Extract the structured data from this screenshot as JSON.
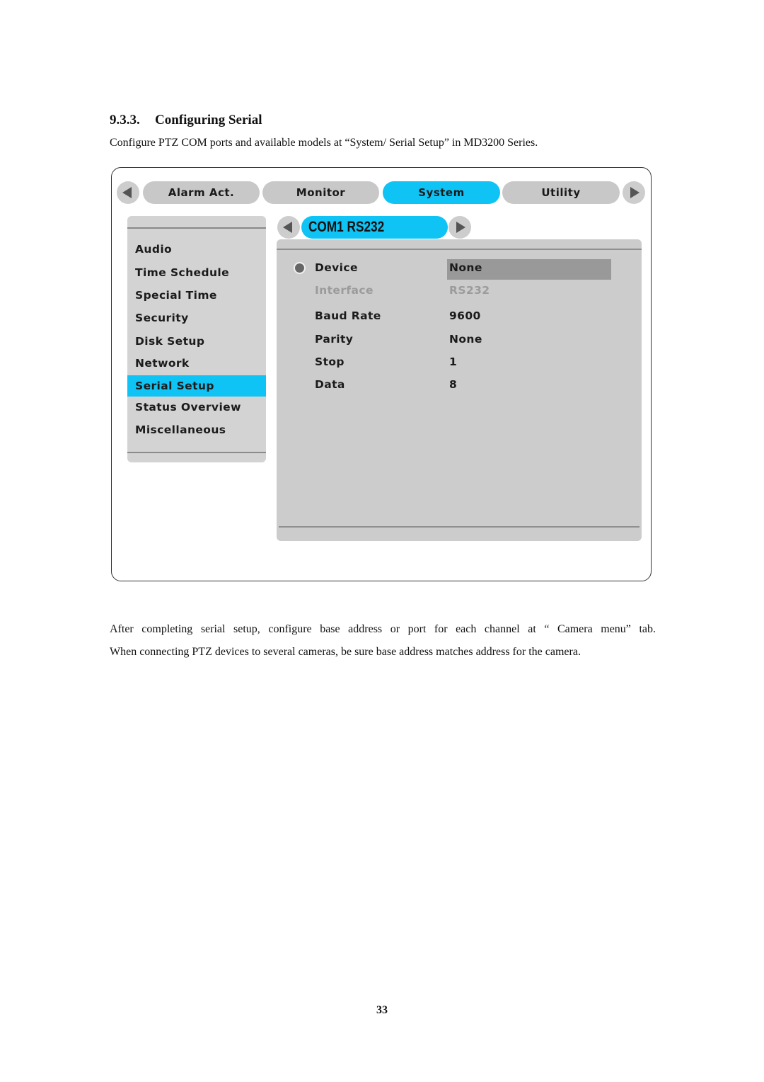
{
  "document": {
    "section_number": "9.3.3.",
    "section_title": "Configuring Serial",
    "intro": "Configure PTZ COM ports and available models at “System/ Serial Setup” in MD3200 Series.",
    "paragraphs": [
      "After completing serial setup, configure base address or port for each channel at “ Camera menu” tab.",
      "When connecting PTZ devices to several cameras, be sure base address matches address for the camera."
    ],
    "page_number": "33"
  },
  "screenshot": {
    "top_tabs": [
      {
        "label": "Alarm Act.",
        "active": false
      },
      {
        "label": "Monitor",
        "active": false
      },
      {
        "label": "System",
        "active": true
      },
      {
        "label": "Utility",
        "active": false
      }
    ],
    "icons": {
      "prev_tab": "arrow-left-icon",
      "next_tab": "arrow-right-icon",
      "prev_port": "arrow-left-icon",
      "next_port": "arrow-right-icon",
      "focus_marker": "radio-dot-icon"
    },
    "sidebar": {
      "items": [
        {
          "label": "Audio",
          "active": false
        },
        {
          "label": "Time Schedule",
          "active": false
        },
        {
          "label": "Special Time",
          "active": false
        },
        {
          "label": "Security",
          "active": false
        },
        {
          "label": "Disk Setup",
          "active": false
        },
        {
          "label": "Network",
          "active": false
        },
        {
          "label": "Serial Setup",
          "active": true
        },
        {
          "label": "Status Overview",
          "active": false
        },
        {
          "label": "Miscellaneous",
          "active": false
        }
      ]
    },
    "port_selector": {
      "label": "COM1 RS232"
    },
    "settings": [
      {
        "label": "Device",
        "value": "None",
        "focused": true,
        "disabled": false
      },
      {
        "label": "Interface",
        "value": "RS232",
        "focused": false,
        "disabled": true
      },
      {
        "label": "Baud Rate",
        "value": "9600",
        "focused": false,
        "disabled": false
      },
      {
        "label": "Parity",
        "value": "None",
        "focused": false,
        "disabled": false
      },
      {
        "label": "Stop",
        "value": "1",
        "focused": false,
        "disabled": false
      },
      {
        "label": "Data",
        "value": "8",
        "focused": false,
        "disabled": false
      }
    ],
    "colors": {
      "active_highlight": "#0fc3f5",
      "panel_gray": "#cccccc",
      "tab_gray": "#c8c8c8",
      "selected_value_box": "#999999",
      "disabled_text": "#9b9b9b"
    }
  }
}
